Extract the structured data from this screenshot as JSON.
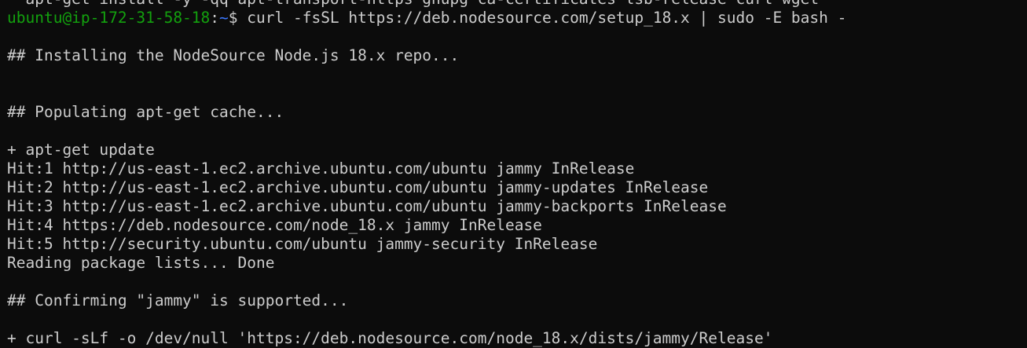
{
  "terminal": {
    "partial_top_line": "  apt-get install -y -qq apt-transport-https gnupg ca-certificates lsb-release curl wget",
    "prompt": {
      "user_host": "ubuntu@ip-172-31-58-18",
      "separator": ":",
      "path": "~",
      "symbol": "$",
      "command": " curl -fsSL https://deb.nodesource.com/setup_18.x | sudo -E bash -"
    },
    "output": [
      "",
      "## Installing the NodeSource Node.js 18.x repo...",
      "",
      "",
      "## Populating apt-get cache...",
      "",
      "+ apt-get update",
      "Hit:1 http://us-east-1.ec2.archive.ubuntu.com/ubuntu jammy InRelease",
      "Hit:2 http://us-east-1.ec2.archive.ubuntu.com/ubuntu jammy-updates InRelease",
      "Hit:3 http://us-east-1.ec2.archive.ubuntu.com/ubuntu jammy-backports InRelease",
      "Hit:4 https://deb.nodesource.com/node_18.x jammy InRelease",
      "Hit:5 http://security.ubuntu.com/ubuntu jammy-security InRelease",
      "Reading package lists... Done",
      "",
      "## Confirming \"jammy\" is supported...",
      "",
      "+ curl -sLf -o /dev/null 'https://deb.nodesource.com/node_18.x/dists/jammy/Release'"
    ],
    "colors": {
      "background": "#0c0c0c",
      "text": "#cccccc",
      "user_host": "#13a10e",
      "path": "#3b78ff"
    }
  }
}
